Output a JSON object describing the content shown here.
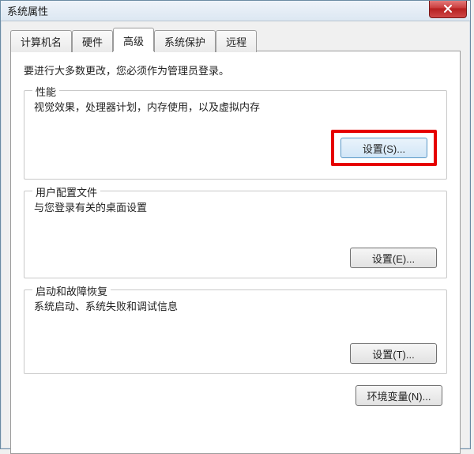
{
  "titlebar": {
    "title": "系统属性"
  },
  "tabs": {
    "computer_name": "计算机名",
    "hardware": "硬件",
    "advanced": "高级",
    "system_protection": "系统保护",
    "remote": "远程"
  },
  "main": {
    "intro": "要进行大多数更改，您必须作为管理员登录。",
    "performance": {
      "legend": "性能",
      "desc": "视觉效果，处理器计划，内存使用，以及虚拟内存",
      "button": "设置(S)..."
    },
    "user_profile": {
      "legend": "用户配置文件",
      "desc": "与您登录有关的桌面设置",
      "button": "设置(E)..."
    },
    "startup": {
      "legend": "启动和故障恢复",
      "desc": "系统启动、系统失败和调试信息",
      "button": "设置(T)..."
    },
    "env_vars_button": "环境变量(N)..."
  }
}
